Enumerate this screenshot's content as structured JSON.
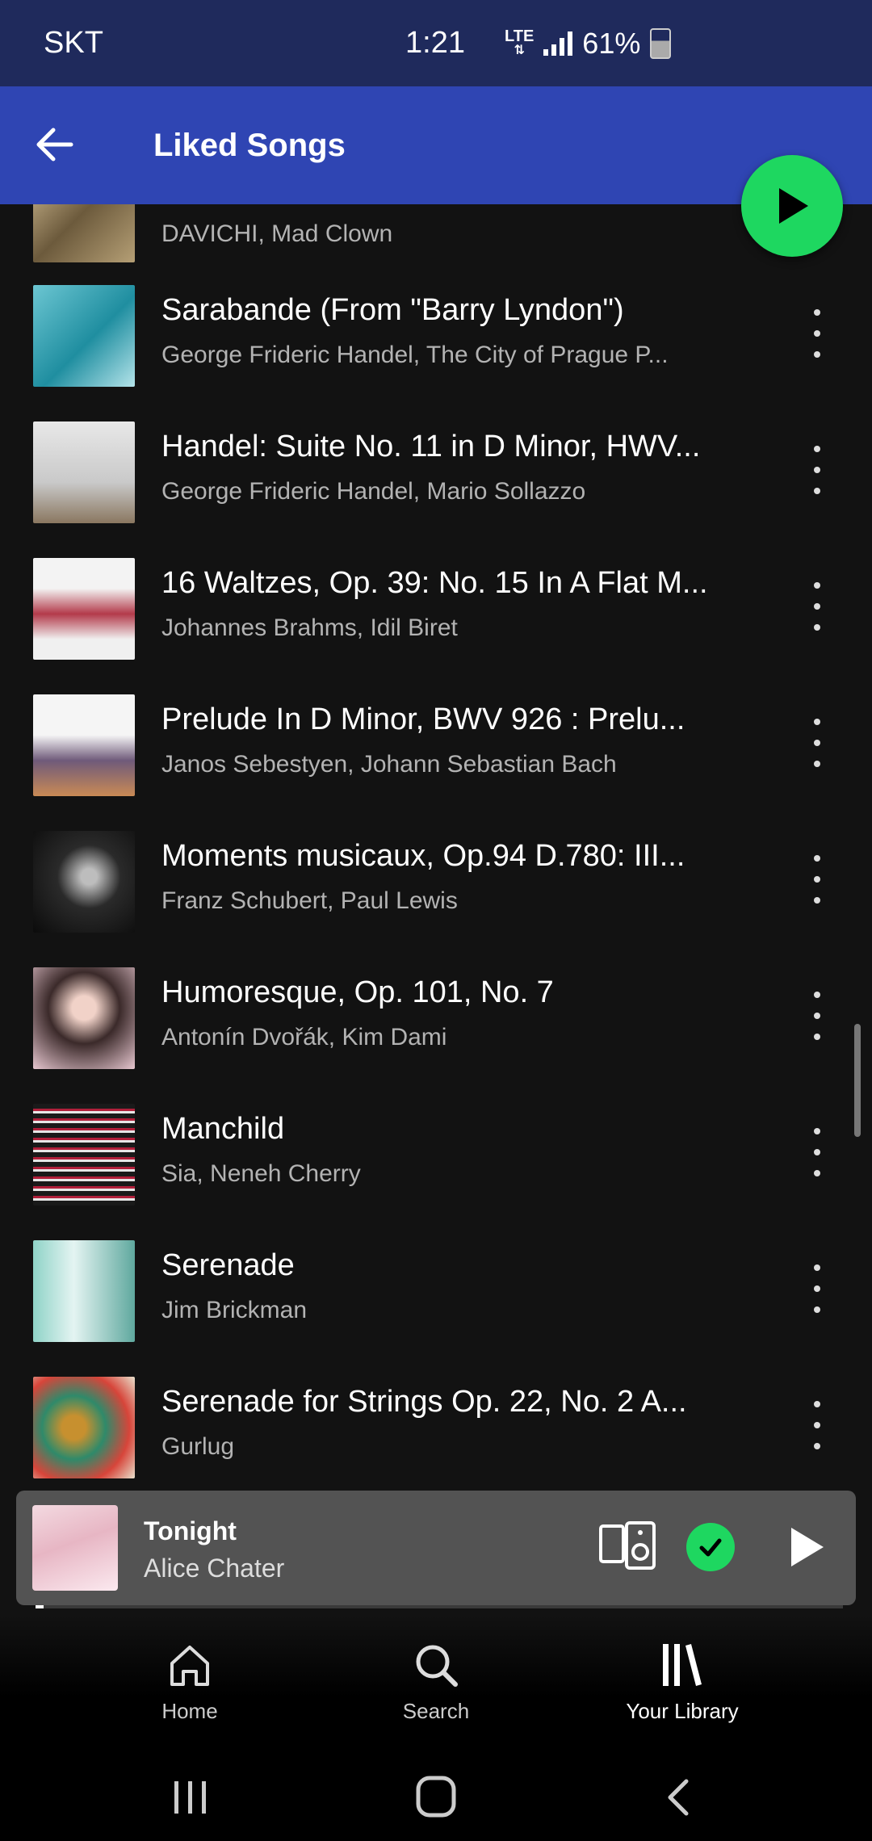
{
  "status_bar": {
    "carrier": "SKT",
    "time": "1:21",
    "network": "LTE",
    "battery": "61%"
  },
  "header": {
    "title": "Liked Songs"
  },
  "songs": [
    {
      "title": "",
      "artist": "DAVICHI, Mad Clown"
    },
    {
      "title": "Sarabande (From \"Barry Lyndon\")",
      "artist": "George Frideric Handel, The City of Prague P..."
    },
    {
      "title": "Handel: Suite No. 11 in D Minor, HWV...",
      "artist": "George Frideric Handel, Mario Sollazzo"
    },
    {
      "title": "16 Waltzes, Op. 39: No. 15 In A Flat M...",
      "artist": "Johannes Brahms, Idil Biret"
    },
    {
      "title": "Prelude In D Minor, BWV 926 : Prelu...",
      "artist": "Janos Sebestyen, Johann Sebastian Bach"
    },
    {
      "title": "Moments musicaux, Op.94 D.780: III...",
      "artist": "Franz Schubert, Paul Lewis"
    },
    {
      "title": "Humoresque, Op. 101, No. 7",
      "artist": "Antonín Dvořák, Kim Dami"
    },
    {
      "title": "Manchild",
      "artist": "Sia, Neneh Cherry"
    },
    {
      "title": "Serenade",
      "artist": "Jim Brickman"
    },
    {
      "title": "Serenade for Strings Op. 22, No. 2 A...",
      "artist": "Gurlug"
    }
  ],
  "now_playing": {
    "title": "Tonight",
    "artist": "Alice Chater",
    "liked": true,
    "progress": 0.01
  },
  "bottom_nav": {
    "items": [
      {
        "label": "Home",
        "icon": "home-icon"
      },
      {
        "label": "Search",
        "icon": "search-icon"
      },
      {
        "label": "Your Library",
        "icon": "library-icon",
        "active": true
      }
    ]
  },
  "colors": {
    "accent_green": "#1ed760",
    "header_blue": "#2f45b3",
    "status_blue": "#1f2a5c",
    "background": "#121212"
  }
}
